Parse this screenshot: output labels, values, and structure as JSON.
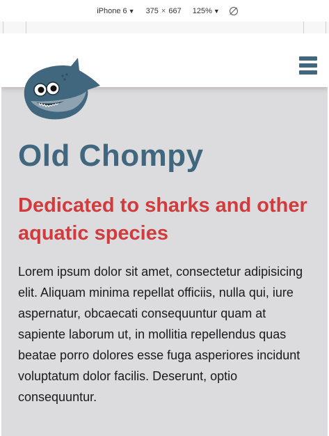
{
  "devtools": {
    "device": "iPhone 6",
    "width": "375",
    "times": "×",
    "height": "667",
    "zoom": "125%"
  },
  "site": {
    "title": "Old Chompy",
    "tagline": "Dedicated to sharks and other aquatic species",
    "body": "Lorem ipsum dolor sit amet, consectetur adipisicing elit. Aliquam minima repellat officiis, nulla qui, iure aspernatur, obcaecati consequuntur quam at sapiente laborum ut, in mollitia repellendus quas beatae porro dolores esse fuga asperiores incidunt voluptatum dolor facilis. Deserunt, optio consequuntur."
  },
  "colors": {
    "brand_blue": "#41677f",
    "brand_red": "#d13b3d",
    "page_bg": "#dcdbdd"
  },
  "icons": {
    "menu": "hamburger-menu-icon",
    "logo": "shark-logo",
    "rotate": "rotate-icon"
  }
}
